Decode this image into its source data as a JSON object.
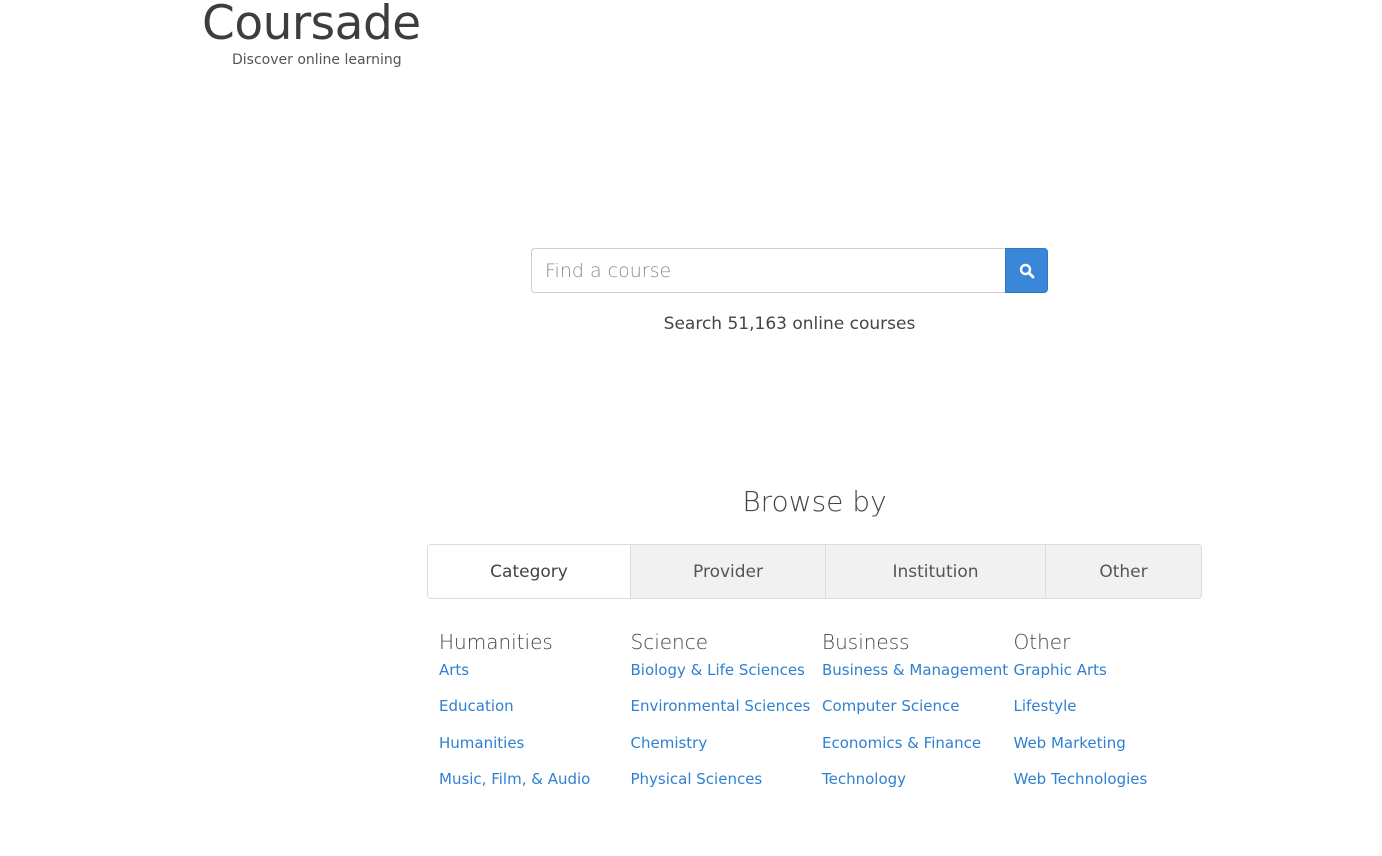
{
  "brand": {
    "title": "Coursade",
    "tagline": "Discover online learning"
  },
  "search": {
    "placeholder": "Find a course",
    "value": "",
    "button_icon": "search-icon",
    "caption": "Search 51,163 online courses"
  },
  "browse": {
    "heading": "Browse by",
    "tabs": [
      {
        "label": "Category",
        "active": true
      },
      {
        "label": "Provider",
        "active": false
      },
      {
        "label": "Institution",
        "active": false
      },
      {
        "label": "Other",
        "active": false
      }
    ],
    "columns": [
      {
        "heading": "Humanities",
        "links": [
          "Arts",
          "Education",
          "Humanities",
          "Music, Film, & Audio"
        ]
      },
      {
        "heading": "Science",
        "links": [
          "Biology & Life Sciences",
          "Environmental Sciences",
          "Chemistry",
          "Physical Sciences"
        ]
      },
      {
        "heading": "Business",
        "links": [
          "Business & Management",
          "Computer Science",
          "Economics & Finance",
          "Technology"
        ]
      },
      {
        "heading": "Other",
        "links": [
          "Graphic Arts",
          "Lifestyle",
          "Web Marketing",
          "Web Technologies"
        ]
      }
    ]
  },
  "colors": {
    "accent": "#3a86d8",
    "link": "#2f80d1",
    "text": "#444444"
  }
}
